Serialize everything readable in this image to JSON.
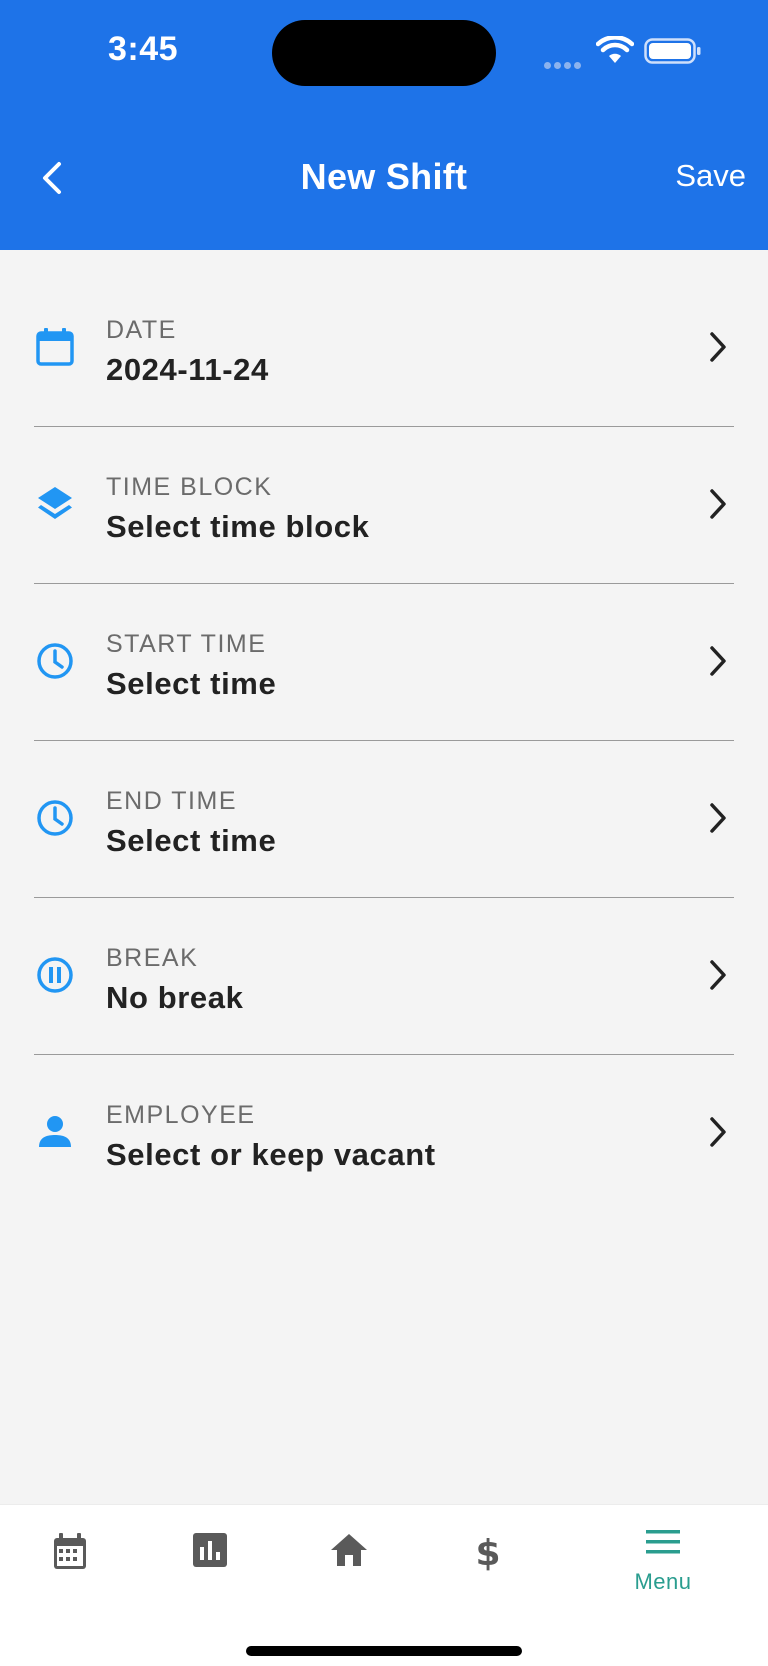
{
  "status_bar": {
    "time": "3:45"
  },
  "header": {
    "title": "New Shift",
    "save_label": "Save",
    "back_icon": "chevron-left-icon",
    "background": "#1e73e8"
  },
  "form": {
    "rows": [
      {
        "label": "DATE",
        "value": "2024-11-24",
        "icon": "calendar-icon"
      },
      {
        "label": "TIME BLOCK",
        "value": "Select time block",
        "icon": "layers-icon"
      },
      {
        "label": "START TIME",
        "value": "Select time",
        "icon": "clock-icon"
      },
      {
        "label": "END TIME",
        "value": "Select time",
        "icon": "clock-icon"
      },
      {
        "label": "BREAK",
        "value": "No break",
        "icon": "pause-circle-icon"
      },
      {
        "label": "EMPLOYEE",
        "value": "Select or keep vacant",
        "icon": "person-icon"
      }
    ],
    "icon_color": "#2196f3"
  },
  "tabbar": {
    "items": [
      {
        "icon": "calendar-grid-icon"
      },
      {
        "icon": "bar-chart-icon"
      },
      {
        "icon": "home-icon"
      },
      {
        "icon": "dollar-icon"
      },
      {
        "icon": "menu-icon",
        "label": "Menu",
        "active": true
      }
    ],
    "active_color": "#2a9d8f",
    "inactive_color": "#5a5a5a"
  }
}
